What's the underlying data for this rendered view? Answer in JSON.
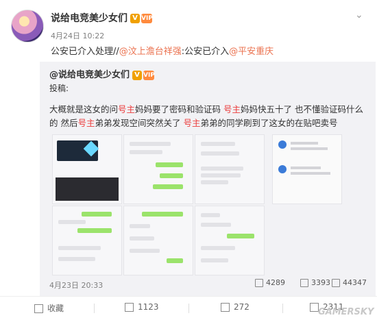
{
  "post": {
    "author": "说给电竞美少女们",
    "verified_badge": "V",
    "level_badge": "VIP",
    "time": "4月24日 10:22",
    "text_prefix": "公安已介入处理//",
    "mention1": "@汶上澹台祥强",
    "text_mid": ":公安已介入",
    "mention2": "@平安重庆"
  },
  "repost": {
    "author": "@说给电竞美少女们",
    "label": "投稿:",
    "body": [
      {
        "t": "大概就是这女的问",
        "hl": false
      },
      {
        "t": "号主",
        "hl": true
      },
      {
        "t": "妈妈要了密码和验证码 ",
        "hl": false
      },
      {
        "t": "号主",
        "hl": true
      },
      {
        "t": "妈妈快五十了 也不懂验证码什么的 然后",
        "hl": false
      },
      {
        "t": "号主",
        "hl": true
      },
      {
        "t": "弟弟发现空间突然关了 ",
        "hl": false
      },
      {
        "t": "号主",
        "hl": true
      },
      {
        "t": "弟弟的同学刷到了这女的在贴吧卖号",
        "hl": false
      }
    ],
    "time": "4月23日 20:33",
    "shares": "4289",
    "comments": "3393",
    "likes": "44347"
  },
  "actions": {
    "favorite": "收藏",
    "repost_count": "1123",
    "comment_count": "272",
    "like_count": "2311"
  },
  "watermark": "GAMERSKY",
  "colors": {
    "link": "#eb7350",
    "highlight": "#eb3c3c",
    "badge": "#f0a000"
  }
}
